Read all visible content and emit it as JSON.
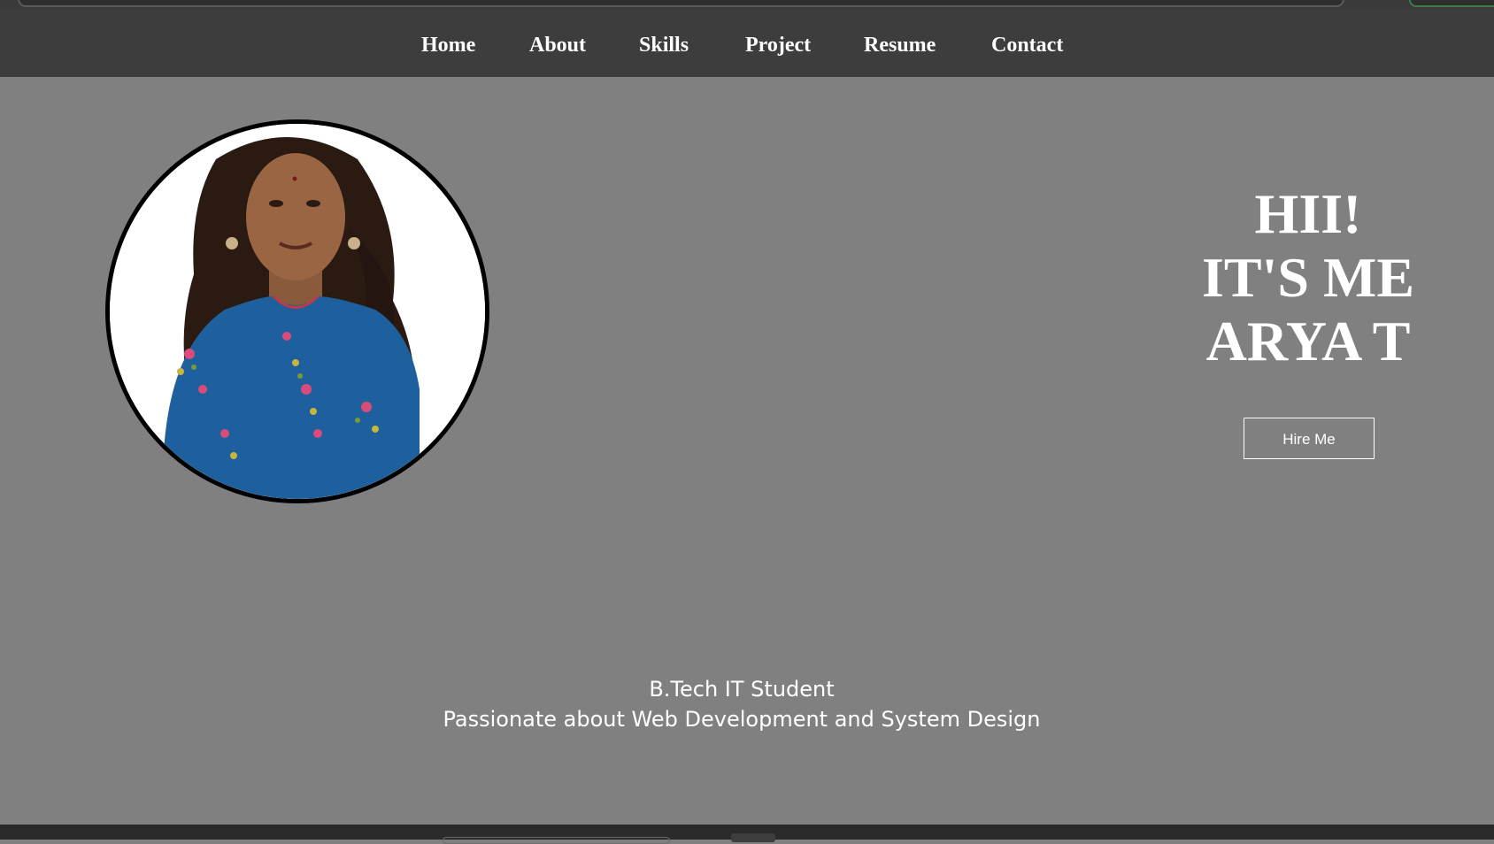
{
  "nav": {
    "items": [
      {
        "label": "Home"
      },
      {
        "label": "About"
      },
      {
        "label": "Skills"
      },
      {
        "label": "Project"
      },
      {
        "label": "Resume"
      },
      {
        "label": "Contact"
      }
    ]
  },
  "hero": {
    "greeting_lines": [
      "HII!",
      "IT'S ME",
      "ARYA T"
    ],
    "hire_button": "Hire Me",
    "tagline_lines": [
      "B.Tech IT Student",
      "Passionate about Web Development and System Design"
    ]
  },
  "colors": {
    "page_background": "#808080",
    "navbar_background": "#3d3d3d",
    "text": "#ffffff",
    "photo_border": "#000000",
    "kurta_blue": "#1e5f9e"
  },
  "icons": {
    "profile_photo": "person-portrait-image"
  }
}
